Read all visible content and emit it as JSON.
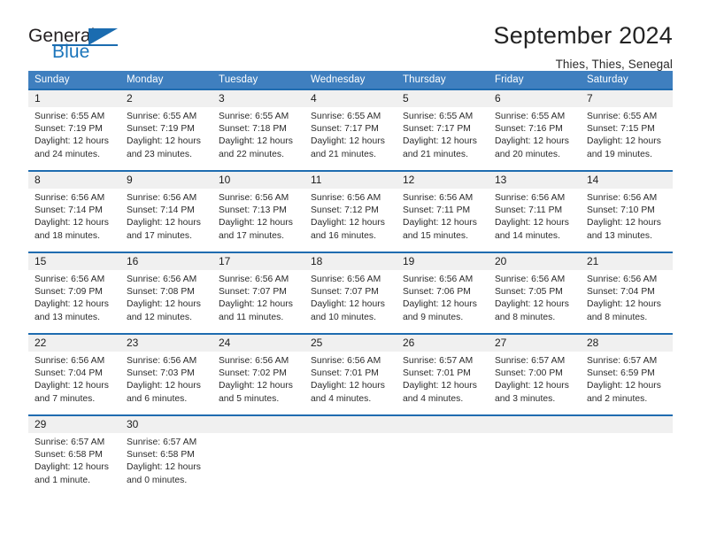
{
  "brand": {
    "name_part1": "General",
    "name_part2": "Blue",
    "logo_icon": "blue-triangle-flag-icon"
  },
  "header": {
    "title": "September 2024",
    "location": "Thies, Thies, Senegal"
  },
  "calendar": {
    "weekday_headers": [
      "Sunday",
      "Monday",
      "Tuesday",
      "Wednesday",
      "Thursday",
      "Friday",
      "Saturday"
    ],
    "labels": {
      "sunrise": "Sunrise:",
      "sunset": "Sunset:",
      "daylight": "Daylight:"
    },
    "colors": {
      "header_blue": "#3f7fbf",
      "border_blue": "#1f6cb0",
      "daynum_band": "#f0f0f0",
      "brand_blue": "#1b75bb"
    },
    "weeks": [
      [
        {
          "day": "1",
          "sunrise": "Sunrise: 6:55 AM",
          "sunset": "Sunset: 7:19 PM",
          "daylight": "Daylight: 12 hours and 24 minutes."
        },
        {
          "day": "2",
          "sunrise": "Sunrise: 6:55 AM",
          "sunset": "Sunset: 7:19 PM",
          "daylight": "Daylight: 12 hours and 23 minutes."
        },
        {
          "day": "3",
          "sunrise": "Sunrise: 6:55 AM",
          "sunset": "Sunset: 7:18 PM",
          "daylight": "Daylight: 12 hours and 22 minutes."
        },
        {
          "day": "4",
          "sunrise": "Sunrise: 6:55 AM",
          "sunset": "Sunset: 7:17 PM",
          "daylight": "Daylight: 12 hours and 21 minutes."
        },
        {
          "day": "5",
          "sunrise": "Sunrise: 6:55 AM",
          "sunset": "Sunset: 7:17 PM",
          "daylight": "Daylight: 12 hours and 21 minutes."
        },
        {
          "day": "6",
          "sunrise": "Sunrise: 6:55 AM",
          "sunset": "Sunset: 7:16 PM",
          "daylight": "Daylight: 12 hours and 20 minutes."
        },
        {
          "day": "7",
          "sunrise": "Sunrise: 6:55 AM",
          "sunset": "Sunset: 7:15 PM",
          "daylight": "Daylight: 12 hours and 19 minutes."
        }
      ],
      [
        {
          "day": "8",
          "sunrise": "Sunrise: 6:56 AM",
          "sunset": "Sunset: 7:14 PM",
          "daylight": "Daylight: 12 hours and 18 minutes."
        },
        {
          "day": "9",
          "sunrise": "Sunrise: 6:56 AM",
          "sunset": "Sunset: 7:14 PM",
          "daylight": "Daylight: 12 hours and 17 minutes."
        },
        {
          "day": "10",
          "sunrise": "Sunrise: 6:56 AM",
          "sunset": "Sunset: 7:13 PM",
          "daylight": "Daylight: 12 hours and 17 minutes."
        },
        {
          "day": "11",
          "sunrise": "Sunrise: 6:56 AM",
          "sunset": "Sunset: 7:12 PM",
          "daylight": "Daylight: 12 hours and 16 minutes."
        },
        {
          "day": "12",
          "sunrise": "Sunrise: 6:56 AM",
          "sunset": "Sunset: 7:11 PM",
          "daylight": "Daylight: 12 hours and 15 minutes."
        },
        {
          "day": "13",
          "sunrise": "Sunrise: 6:56 AM",
          "sunset": "Sunset: 7:11 PM",
          "daylight": "Daylight: 12 hours and 14 minutes."
        },
        {
          "day": "14",
          "sunrise": "Sunrise: 6:56 AM",
          "sunset": "Sunset: 7:10 PM",
          "daylight": "Daylight: 12 hours and 13 minutes."
        }
      ],
      [
        {
          "day": "15",
          "sunrise": "Sunrise: 6:56 AM",
          "sunset": "Sunset: 7:09 PM",
          "daylight": "Daylight: 12 hours and 13 minutes."
        },
        {
          "day": "16",
          "sunrise": "Sunrise: 6:56 AM",
          "sunset": "Sunset: 7:08 PM",
          "daylight": "Daylight: 12 hours and 12 minutes."
        },
        {
          "day": "17",
          "sunrise": "Sunrise: 6:56 AM",
          "sunset": "Sunset: 7:07 PM",
          "daylight": "Daylight: 12 hours and 11 minutes."
        },
        {
          "day": "18",
          "sunrise": "Sunrise: 6:56 AM",
          "sunset": "Sunset: 7:07 PM",
          "daylight": "Daylight: 12 hours and 10 minutes."
        },
        {
          "day": "19",
          "sunrise": "Sunrise: 6:56 AM",
          "sunset": "Sunset: 7:06 PM",
          "daylight": "Daylight: 12 hours and 9 minutes."
        },
        {
          "day": "20",
          "sunrise": "Sunrise: 6:56 AM",
          "sunset": "Sunset: 7:05 PM",
          "daylight": "Daylight: 12 hours and 8 minutes."
        },
        {
          "day": "21",
          "sunrise": "Sunrise: 6:56 AM",
          "sunset": "Sunset: 7:04 PM",
          "daylight": "Daylight: 12 hours and 8 minutes."
        }
      ],
      [
        {
          "day": "22",
          "sunrise": "Sunrise: 6:56 AM",
          "sunset": "Sunset: 7:04 PM",
          "daylight": "Daylight: 12 hours and 7 minutes."
        },
        {
          "day": "23",
          "sunrise": "Sunrise: 6:56 AM",
          "sunset": "Sunset: 7:03 PM",
          "daylight": "Daylight: 12 hours and 6 minutes."
        },
        {
          "day": "24",
          "sunrise": "Sunrise: 6:56 AM",
          "sunset": "Sunset: 7:02 PM",
          "daylight": "Daylight: 12 hours and 5 minutes."
        },
        {
          "day": "25",
          "sunrise": "Sunrise: 6:56 AM",
          "sunset": "Sunset: 7:01 PM",
          "daylight": "Daylight: 12 hours and 4 minutes."
        },
        {
          "day": "26",
          "sunrise": "Sunrise: 6:57 AM",
          "sunset": "Sunset: 7:01 PM",
          "daylight": "Daylight: 12 hours and 4 minutes."
        },
        {
          "day": "27",
          "sunrise": "Sunrise: 6:57 AM",
          "sunset": "Sunset: 7:00 PM",
          "daylight": "Daylight: 12 hours and 3 minutes."
        },
        {
          "day": "28",
          "sunrise": "Sunrise: 6:57 AM",
          "sunset": "Sunset: 6:59 PM",
          "daylight": "Daylight: 12 hours and 2 minutes."
        }
      ],
      [
        {
          "day": "29",
          "sunrise": "Sunrise: 6:57 AM",
          "sunset": "Sunset: 6:58 PM",
          "daylight": "Daylight: 12 hours and 1 minute."
        },
        {
          "day": "30",
          "sunrise": "Sunrise: 6:57 AM",
          "sunset": "Sunset: 6:58 PM",
          "daylight": "Daylight: 12 hours and 0 minutes."
        },
        {
          "day": "",
          "sunrise": "",
          "sunset": "",
          "daylight": ""
        },
        {
          "day": "",
          "sunrise": "",
          "sunset": "",
          "daylight": ""
        },
        {
          "day": "",
          "sunrise": "",
          "sunset": "",
          "daylight": ""
        },
        {
          "day": "",
          "sunrise": "",
          "sunset": "",
          "daylight": ""
        },
        {
          "day": "",
          "sunrise": "",
          "sunset": "",
          "daylight": ""
        }
      ]
    ]
  }
}
